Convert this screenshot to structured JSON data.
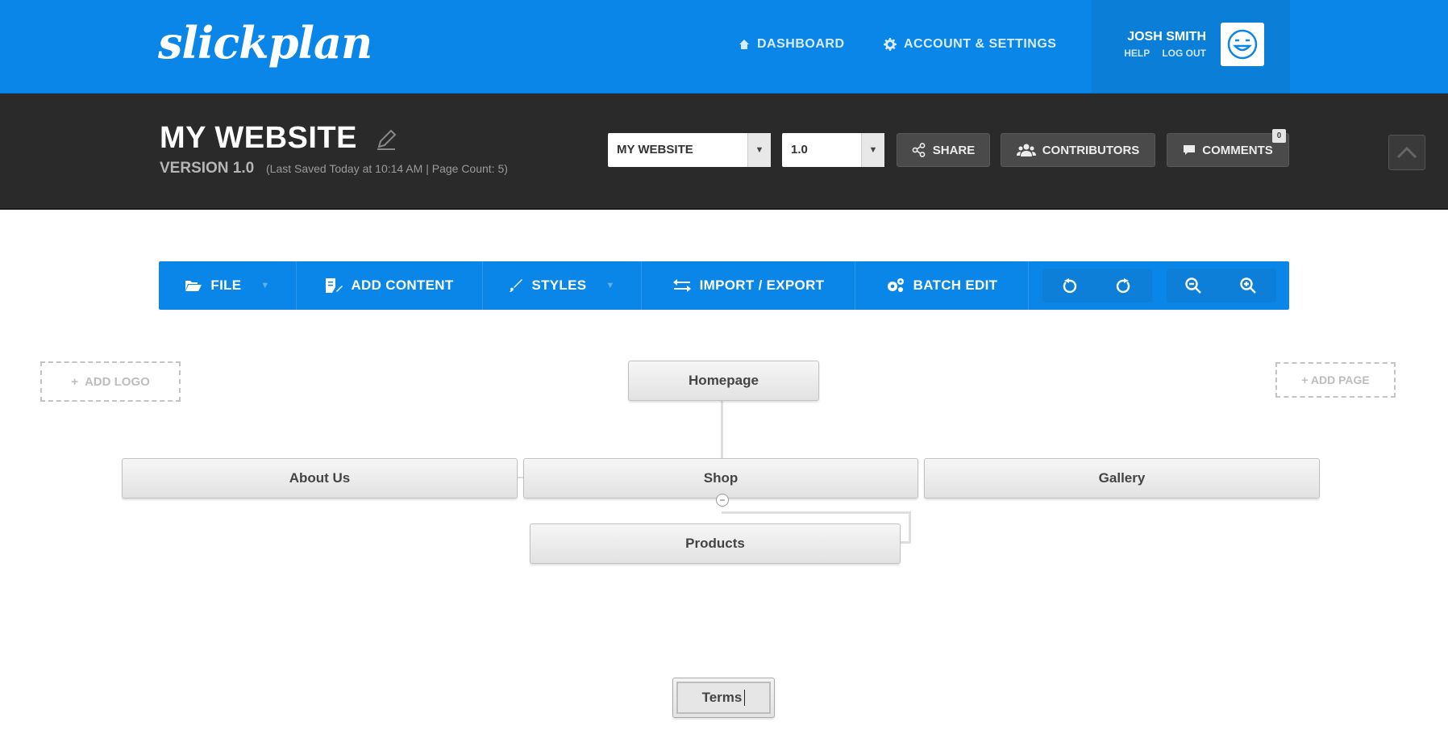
{
  "brand": {
    "logo_text": "slickplan"
  },
  "topnav": {
    "dashboard": "DASHBOARD",
    "account": "ACCOUNT & SETTINGS"
  },
  "user": {
    "name": "JOSH SMITH",
    "help": "HELP",
    "logout": "LOG OUT"
  },
  "project": {
    "title": "MY WEBSITE",
    "version": "VERSION 1.0",
    "meta": "(Last Saved Today at 10:14 AM  |  Page Count: 5)",
    "project_select": "MY WEBSITE",
    "version_select": "1.0",
    "share": "SHARE",
    "contributors": "CONTRIBUTORS",
    "comments": "COMMENTS",
    "comments_count": "0"
  },
  "toolbar": {
    "file": "FILE",
    "add_content": "ADD CONTENT",
    "styles": "STYLES",
    "import_export": "IMPORT / EXPORT",
    "batch_edit": "BATCH EDIT"
  },
  "canvas": {
    "add_logo": "ADD LOGO",
    "add_page": "+ ADD PAGE",
    "pages": {
      "homepage": "Homepage",
      "about": "About Us",
      "shop": "Shop",
      "gallery": "Gallery",
      "products": "Products",
      "terms": "Terms"
    }
  },
  "colors": {
    "primary_blue": "#0a86e8",
    "dark_bar": "#2a2a2a"
  }
}
